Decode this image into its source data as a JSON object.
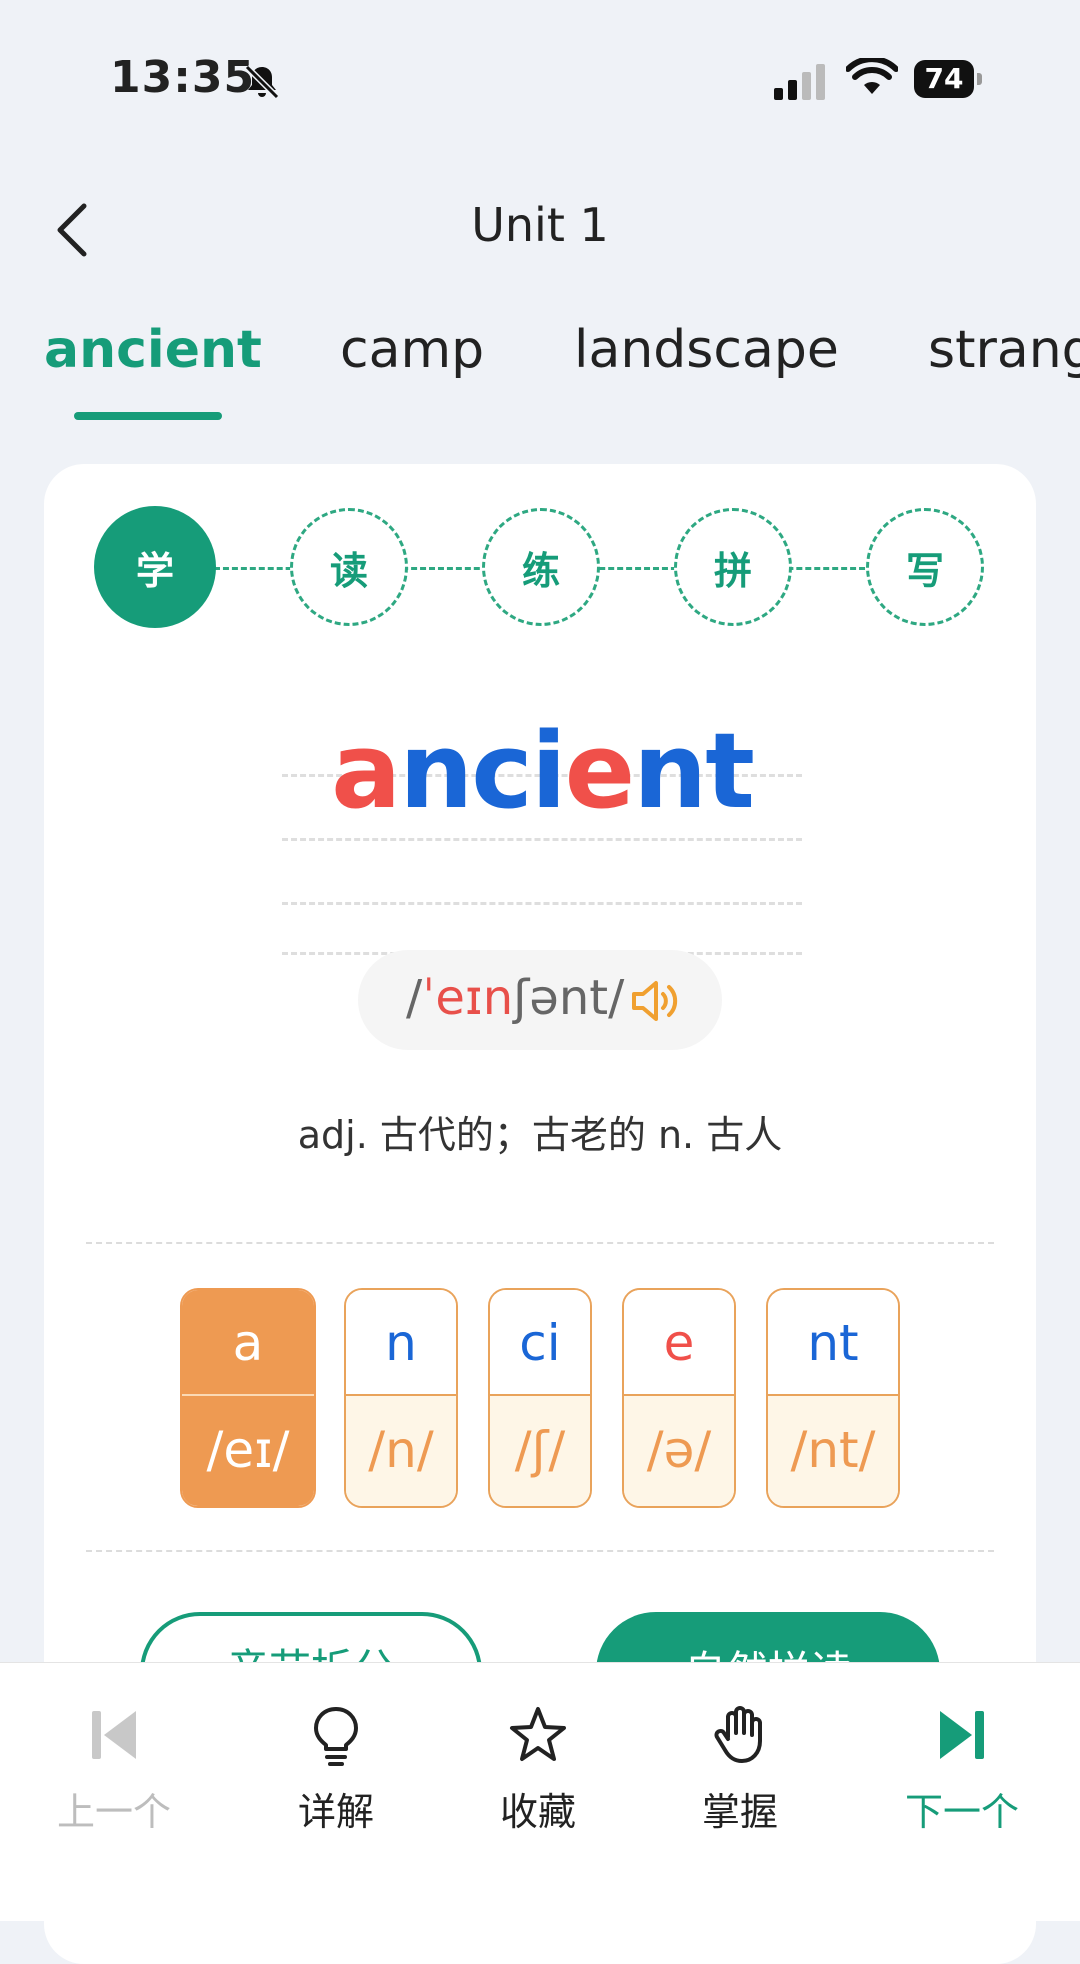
{
  "status": {
    "time": "13:35",
    "battery": "74"
  },
  "nav": {
    "title": "Unit 1"
  },
  "tabs": [
    {
      "label": "ancient",
      "active": true
    },
    {
      "label": "camp"
    },
    {
      "label": "landscape"
    },
    {
      "label": "strang"
    }
  ],
  "steps": [
    "学",
    "读",
    "练",
    "拼",
    "写"
  ],
  "word": {
    "letters": [
      {
        "char": "a",
        "color": "#f0504a"
      },
      {
        "char": "n",
        "color": "#1a66d6"
      },
      {
        "char": "c",
        "color": "#1a66d6"
      },
      {
        "char": "i",
        "color": "#1a66d6"
      },
      {
        "char": "e",
        "color": "#f0504a"
      },
      {
        "char": "n",
        "color": "#1a66d6"
      },
      {
        "char": "t",
        "color": "#1a66d6"
      }
    ]
  },
  "phonetic": {
    "parts": [
      {
        "text": "/",
        "color": "#666666"
      },
      {
        "text": "ˈeɪn",
        "color": "#e8504a"
      },
      {
        "text": "ʃənt",
        "color": "#666666"
      },
      {
        "text": "/",
        "color": "#666666"
      }
    ]
  },
  "definition": "adj. 古代的；古老的 n. 古人",
  "syllables": [
    {
      "text": "a",
      "ipa": "/eɪ/",
      "color": "#ffffff",
      "active": true
    },
    {
      "text": "n",
      "ipa": "/n/",
      "color": "#1a66d6"
    },
    {
      "text": "ci",
      "ipa": "/ʃ/",
      "color": "#1a66d6"
    },
    {
      "text": "e",
      "ipa": "/ə/",
      "color": "#f0504a"
    },
    {
      "text": "nt",
      "ipa": "/nt/",
      "color": "#1a66d6"
    }
  ],
  "buttons": {
    "left": "音节拆分",
    "right": "自然拼读"
  },
  "bottom": {
    "prev": "上一个",
    "detail": "详解",
    "favorite": "收藏",
    "master": "掌握",
    "next": "下一个"
  },
  "colors": {
    "accent": "#169c79",
    "orange": "#ee9a52"
  }
}
